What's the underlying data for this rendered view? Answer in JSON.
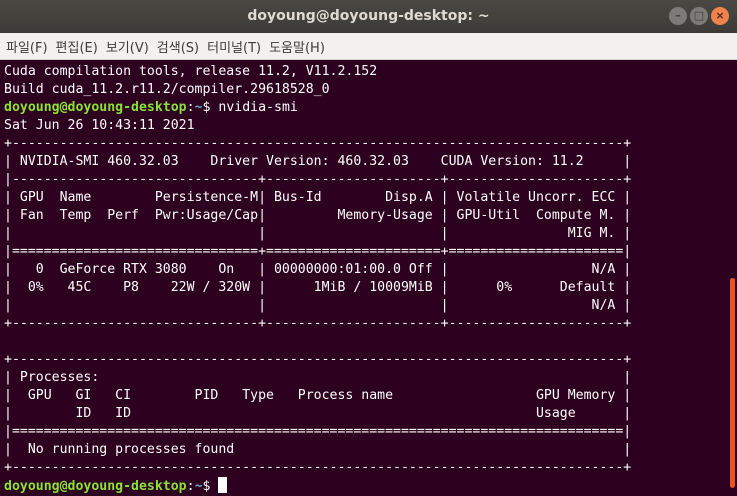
{
  "window": {
    "title": "doyoung@doyoung-desktop: ~",
    "buttons": {
      "minimize": "–",
      "maximize": "□",
      "close": "×"
    }
  },
  "menu": [
    "파일(F)",
    "편집(E)",
    "보기(V)",
    "검색(S)",
    "터미널(T)",
    "도움말(H)"
  ],
  "terminal": {
    "prompt": {
      "user_host": "doyoung@doyoung-desktop",
      "sep": ":",
      "path": "~",
      "symbol": "$ "
    },
    "command": "nvidia-smi",
    "lines_before": [
      "Cuda compilation tools, release 11.2, V11.2.152",
      "Build cuda_11.2.r11.2/compiler.29618528_0"
    ],
    "output": [
      "Sat Jun 26 10:43:11 2021",
      "+-----------------------------------------------------------------------------+",
      "| NVIDIA-SMI 460.32.03    Driver Version: 460.32.03    CUDA Version: 11.2     |",
      "|-------------------------------+----------------------+----------------------+",
      "| GPU  Name        Persistence-M| Bus-Id        Disp.A | Volatile Uncorr. ECC |",
      "| Fan  Temp  Perf  Pwr:Usage/Cap|         Memory-Usage | GPU-Util  Compute M. |",
      "|                               |                      |               MIG M. |",
      "|===============================+======================+======================|",
      "|   0  GeForce RTX 3080    On   | 00000000:01:00.0 Off |                  N/A |",
      "|  0%   45C    P8    22W / 320W |      1MiB / 10009MiB |      0%      Default |",
      "|                               |                      |                  N/A |",
      "+-------------------------------+----------------------+----------------------+",
      "",
      "+-----------------------------------------------------------------------------+",
      "| Processes:                                                                  |",
      "|  GPU   GI   CI        PID   Type   Process name                  GPU Memory |",
      "|        ID   ID                                                   Usage      |",
      "|=============================================================================|",
      "|  No running processes found                                                 |",
      "+-----------------------------------------------------------------------------+"
    ]
  }
}
